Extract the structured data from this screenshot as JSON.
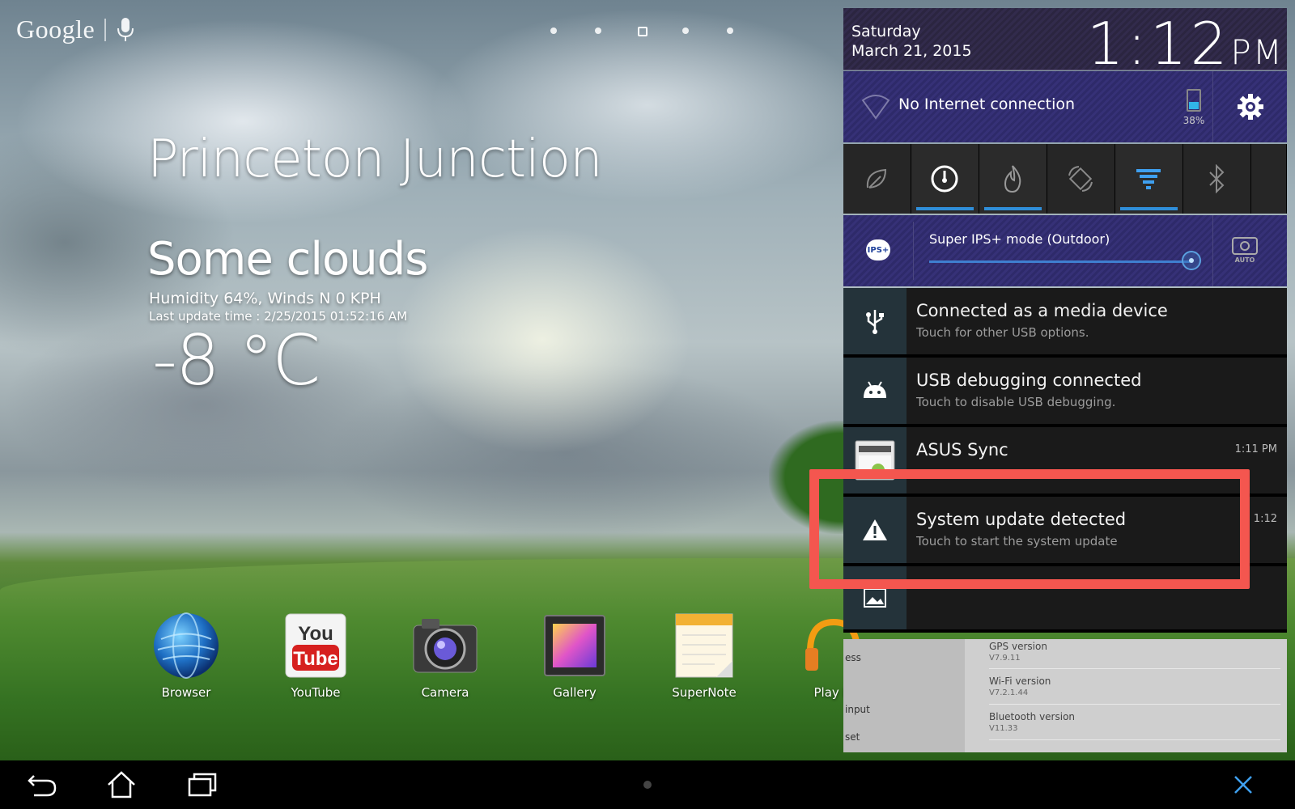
{
  "launcher": {
    "google_label": "Google",
    "page_count": 5,
    "current_page": 3
  },
  "weather": {
    "city": "Princeton Junction",
    "condition": "Some clouds",
    "humidity_wind": "Humidity 64%, Winds N 0 KPH",
    "last_update": "Last update time : 2/25/2015 01:52:16 AM",
    "temperature": "-8 °C"
  },
  "dock": {
    "apps": [
      {
        "label": "Browser",
        "icon": "globe-icon"
      },
      {
        "label": "YouTube",
        "icon": "youtube-icon"
      },
      {
        "label": "Camera",
        "icon": "camera-icon"
      },
      {
        "label": "Gallery",
        "icon": "gallery-icon"
      },
      {
        "label": "SuperNote",
        "icon": "notepad-icon"
      },
      {
        "label": "Play M",
        "icon": "headphones-icon"
      }
    ]
  },
  "shade": {
    "day": "Saturday",
    "date": "March 21, 2015",
    "time": "1:12",
    "ampm": "PM",
    "wifi_label": "No Internet connection",
    "battery_percent": "38%",
    "battery_level": 0.38,
    "toggles": [
      {
        "icon": "leaf-icon",
        "on": false
      },
      {
        "icon": "speedometer-icon",
        "on": true
      },
      {
        "icon": "flame-icon",
        "on": true
      },
      {
        "icon": "rotate-icon",
        "on": false
      },
      {
        "icon": "wifi-funnel-icon",
        "on": true
      },
      {
        "icon": "bluetooth-icon",
        "on": false
      }
    ],
    "ips_badge": "IPS+",
    "ips_label": "Super IPS+ mode (Outdoor)",
    "auto_label": "AUTO",
    "notifications": [
      {
        "title": "Connected as a media device",
        "text": "Touch for other USB options.",
        "time": "",
        "icon": "usb-icon"
      },
      {
        "title": "USB debugging connected",
        "text": "Touch to disable USB debugging.",
        "time": "",
        "icon": "android-icon"
      },
      {
        "title": "ASUS Sync",
        "text": "",
        "time": "1:11 PM",
        "icon": "asus-sync-icon"
      },
      {
        "title": "System update detected",
        "text": "Touch to start the system update",
        "time": "1:12",
        "icon": "warning-icon"
      }
    ]
  },
  "settings_behind": {
    "left_items": [
      "ess",
      "input",
      "set"
    ],
    "right_items": [
      {
        "label": "GPS version",
        "value": "V7.9.11"
      },
      {
        "label": "Wi-Fi version",
        "value": "V7.2.1.44"
      },
      {
        "label": "Bluetooth version",
        "value": "V11.33"
      }
    ]
  },
  "colors": {
    "highlight": "#f4564f",
    "accent": "#2f8ed9",
    "shade_purple": "#322b4c"
  }
}
